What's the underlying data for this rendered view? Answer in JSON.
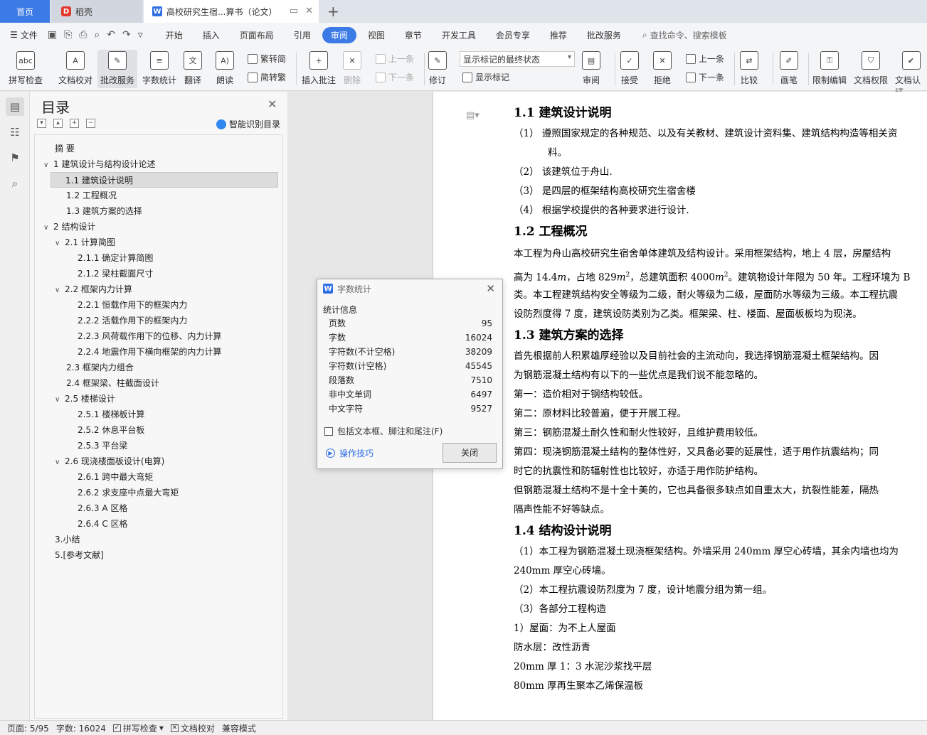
{
  "tabs": {
    "home": "首页",
    "wps": "稻壳",
    "doc": "高校研究生宿...算书（论文）"
  },
  "menu": {
    "file": "文件",
    "items": [
      "开始",
      "插入",
      "页面布局",
      "引用",
      "审阅",
      "视图",
      "章节",
      "开发工具",
      "会员专享",
      "推荐",
      "批改服务"
    ],
    "active": "审阅",
    "search": "查找命令、搜索模板"
  },
  "ribbon": {
    "spell": "拼写检查",
    "doccheck": "文档校对",
    "review_service": "批改服务",
    "wordcount": "字数统计",
    "translate": "翻译",
    "read": "朗读",
    "trad": "繁转简",
    "simp": "简转繁",
    "insert_comment": "插入批注",
    "delete": "删除",
    "prev": "上一条",
    "next": "下一条",
    "revise": "修订",
    "markup_select": "显示标记的最终状态",
    "show_markup": "显示标记",
    "review": "审阅",
    "accept": "接受",
    "reject": "拒绝",
    "prev2": "上一条",
    "next2": "下一条",
    "compare": "比较",
    "pen": "画笔",
    "restrict": "限制编辑",
    "rights": "文档权限",
    "verify": "文档认证"
  },
  "toc": {
    "title": "目录",
    "smart": "智能识别目录",
    "items": [
      "摘    要",
      "1 建筑设计与结构设计论述",
      "1.1 建筑设计说明",
      "1.2 工程概况",
      "1.3 建筑方案的选择",
      "2 结构设计",
      "2.1 计算简图",
      "2.1.1 确定计算简图",
      "2.1.2 梁柱截面尺寸",
      "2.2 框架内力计算",
      "2.2.1 恒载作用下的框架内力",
      "2.2.2 活载作用下的框架内力",
      "2.2.3 风荷载作用下的位移、内力计算",
      "2.2.4 地震作用下横向框架的内力计算",
      "2.3 框架内力组合",
      "2.4 框架梁、柱截面设计",
      "2.5 楼梯设计",
      "2.5.1 楼梯板计算",
      "2.5.2 休息平台板",
      "2.5.3 平台梁",
      "2.6 现浇楼面板设计(电算)",
      "2.6.1 跨中最大弯矩",
      "2.6.2 求支座中点最大弯矩",
      "2.6.3 A 区格",
      "2.6.4 C 区格",
      "3.小结",
      "5.[参考文献]"
    ]
  },
  "dialog": {
    "title": "字数统计",
    "section": "统计信息",
    "rows": [
      {
        "label": "页数",
        "value": "95"
      },
      {
        "label": "字数",
        "value": "16024"
      },
      {
        "label": "字符数(不计空格)",
        "value": "38209"
      },
      {
        "label": "字符数(计空格)",
        "value": "45545"
      },
      {
        "label": "段落数",
        "value": "7510"
      },
      {
        "label": "非中文单词",
        "value": "6497"
      },
      {
        "label": "中文字符",
        "value": "9527"
      }
    ],
    "checkbox": "包括文本框、脚注和尾注(F)",
    "tips": "操作技巧",
    "close": "关闭"
  },
  "doc": {
    "h1": "1.1 建筑设计说明",
    "l1a": "（1）   遵照国家规定的各种规范、以及有关教材、建筑设计资料集、建筑结构构造等相关资",
    "l1b": "料。",
    "l2": "（2）   该建筑位于舟山.",
    "l3": "（3）   是四层的框架结构高校研究生宿舍楼",
    "l4": "（4）   根据学校提供的各种要求进行设计.",
    "h2": "1.2 工程概况",
    "p1": "   本工程为舟山高校研究生宿舍单体建筑及结构设计。采用框架结构，地上 4 层，房屋结构",
    "p2a": "高为 14.4",
    "m1": "m",
    "p2b": "，占地 829",
    "m2": "m",
    "sup2": "2",
    "p2c": "，总建筑面积 4000",
    "m3": "m",
    "sup3": "2",
    "p2d": "。建筑物设计年限为 50 年。工程环境为 B",
    "p3": "类。本工程建筑结构安全等级为二级，耐火等级为二级，屋面防水等级为三级。本工程抗震",
    "p4": "设防烈度得 7 度，建筑设防类别为乙类。框架梁、柱、楼面、屋面板板均为现浇。",
    "h3": "1.3 建筑方案的选择",
    "q1": "       首先根据前人积累雄厚经验以及目前社会的主流动向，我选择钢筋混凝土框架结构。因",
    "q2": "为钢筋混凝土结构有以下的一些优点是我们说不能忽略的。",
    "q3": "      第一：造价相对于钢结构较低。",
    "q4": "      第二：原材料比较普遍，便于开展工程。",
    "q5": "      第三：钢筋混凝土耐久性和耐火性较好，且维护费用较低。",
    "q6": "      第四：现浇钢筋混凝土结构的整体性好，又具备必要的延展性，适于用作抗震结构；同",
    "q7": "时它的抗震性和防辐射性也比较好，亦适于用作防护结构。",
    "q8": "       但钢筋混凝土结构不是十全十美的，它也具备很多缺点如自重太大，抗裂性能差，隔热",
    "q9": "隔声性能不好等缺点。",
    "h4": "1.4 结构设计说明",
    "r1": "    （1）本工程为钢筋混凝土现浇框架结构。外墙采用 240mm 厚空心砖墙，其余内墙也均为",
    "r2": "240mm 厚空心砖墙。",
    "r3": "    （2）本工程抗震设防烈度为 7 度，设计地震分组为第一组。",
    "r4": "    （3）各部分工程构造",
    "r5": "   1）屋面：为不上人屋面",
    "r6": "           防水层：改性沥青",
    "r7": "           20mm 厚 1：3 水泥沙浆找平层",
    "r8": "           80mm 厚再生聚本乙烯保温板"
  },
  "status": {
    "page": "页面: 5/95",
    "words": "字数: 16024",
    "spell": "拼写检查",
    "doccheck": "文档校对",
    "compat": "兼容模式"
  }
}
